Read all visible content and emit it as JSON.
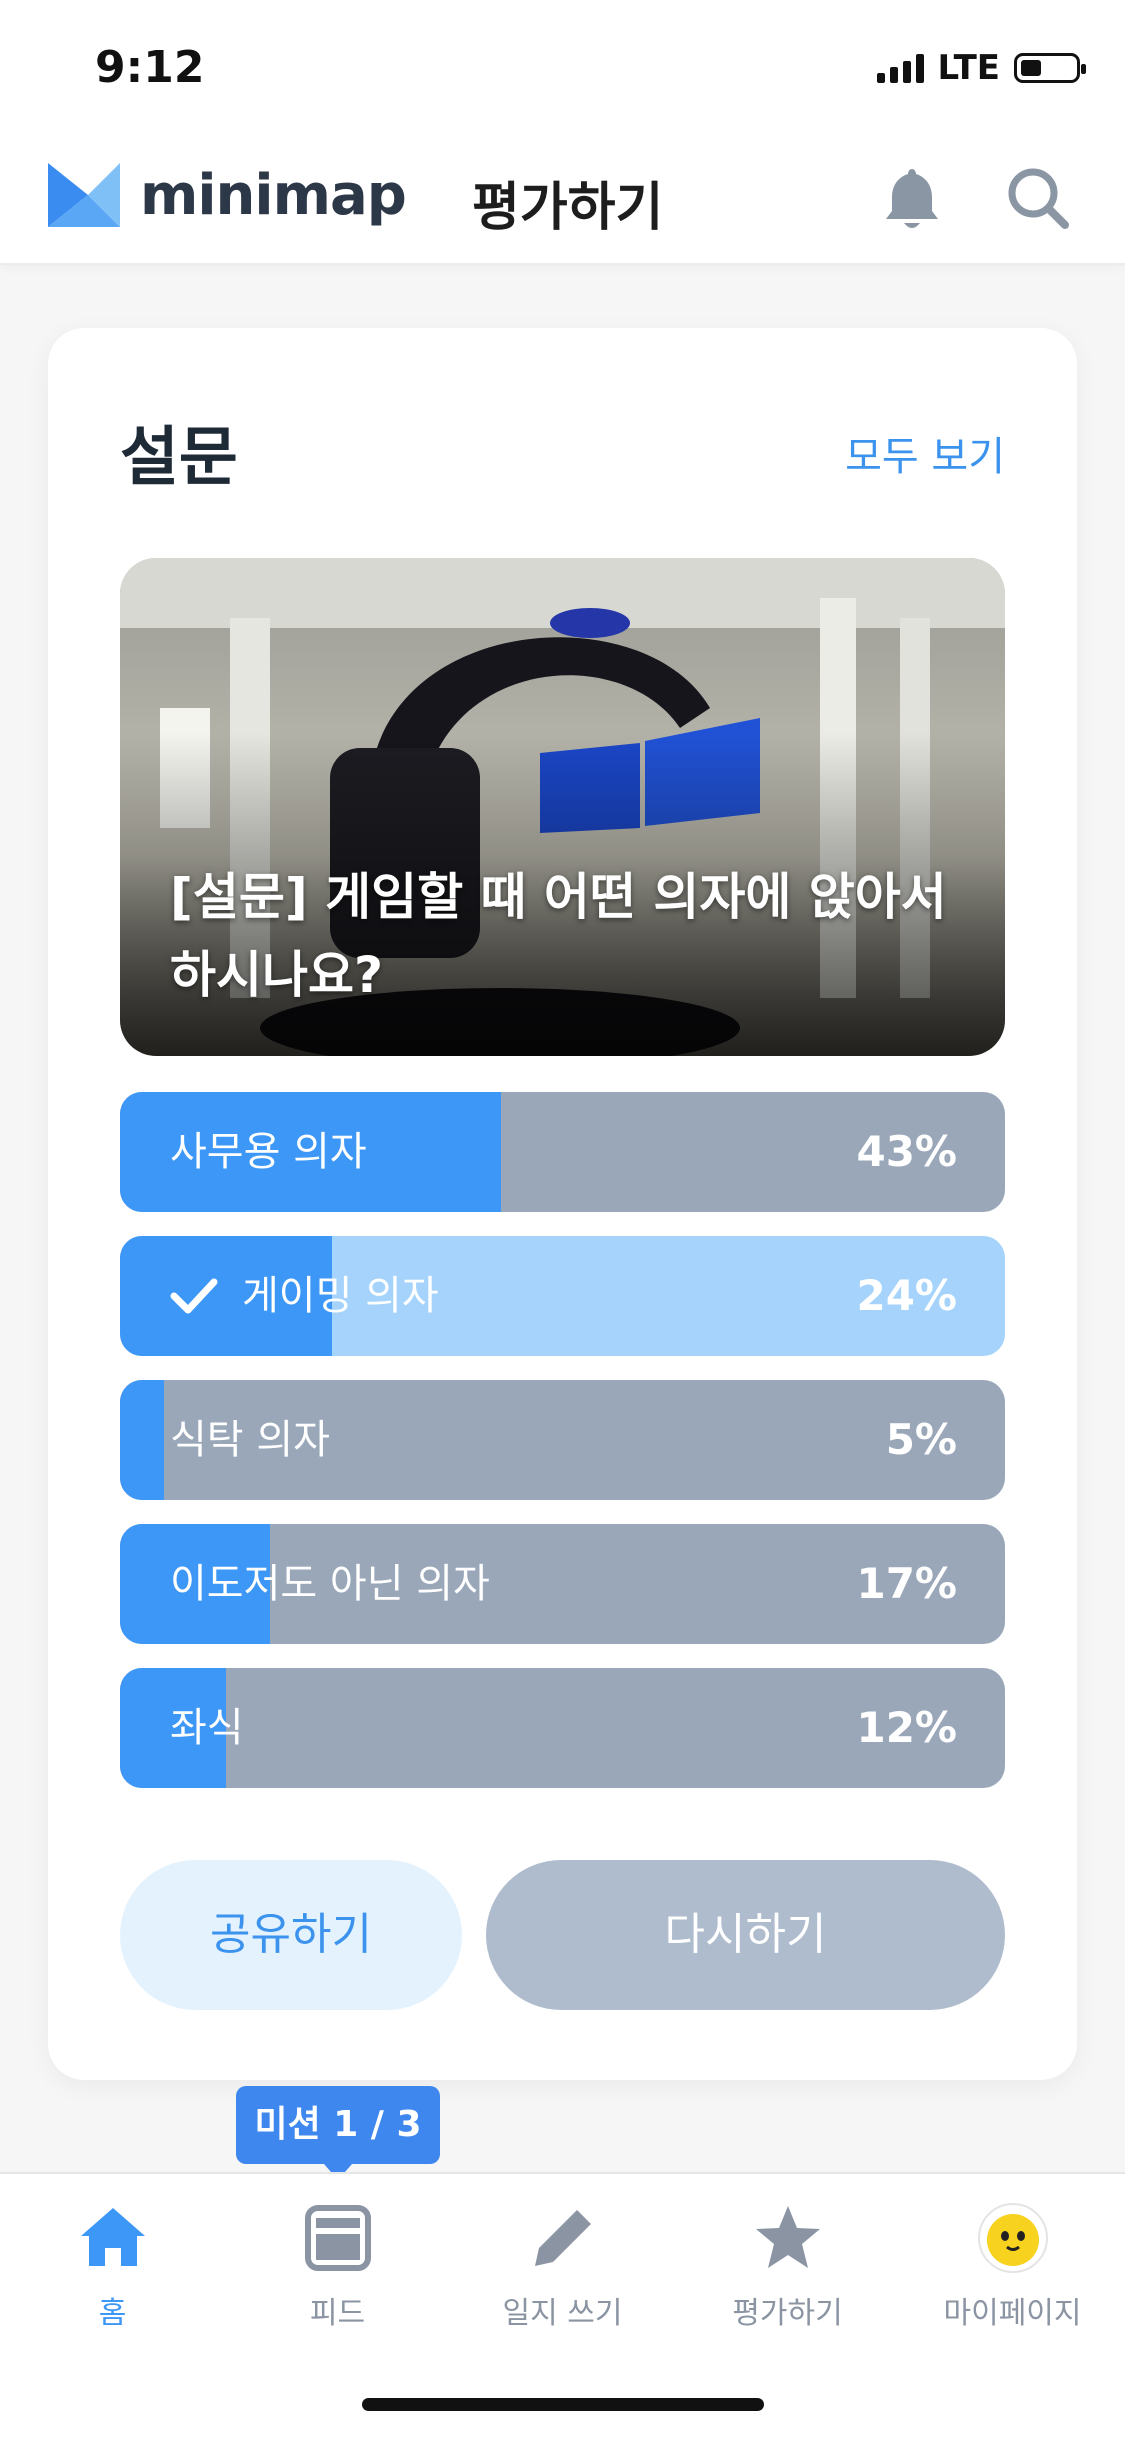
{
  "status_bar": {
    "time": "9:12",
    "network": "LTE"
  },
  "header": {
    "logo_text": "minimap",
    "title": "평가하기"
  },
  "survey_card": {
    "title": "설문",
    "see_all": "모두 보기",
    "question": "[설문] 게임할 때 어떤 의자에 앉아서 하시나요?",
    "options": [
      {
        "label": "사무용 의자",
        "percent": "43%",
        "fraction": 0.43,
        "selected": false
      },
      {
        "label": "게이밍 의자",
        "percent": "24%",
        "fraction": 0.24,
        "selected": true
      },
      {
        "label": "식탁 의자",
        "percent": "5%",
        "fraction": 0.05,
        "selected": false
      },
      {
        "label": "이도저도 아닌 의자",
        "percent": "17%",
        "fraction": 0.17,
        "selected": false
      },
      {
        "label": "좌식",
        "percent": "12%",
        "fraction": 0.12,
        "selected": false
      }
    ],
    "share_button": "공유하기",
    "retry_button": "다시하기"
  },
  "mission_badge": "미션 1 / 3",
  "tabs": [
    {
      "label": "홈",
      "icon": "home-icon",
      "active": true
    },
    {
      "label": "피드",
      "icon": "feed-icon",
      "active": false
    },
    {
      "label": "일지 쓰기",
      "icon": "pencil-icon",
      "active": false
    },
    {
      "label": "평가하기",
      "icon": "star-icon",
      "active": false
    },
    {
      "label": "마이페이지",
      "icon": "avatar-icon",
      "active": false
    }
  ],
  "colors": {
    "accent": "#3d97f6",
    "bar_bg": "#9aa7b9",
    "selected_bg": "#a5d3fb"
  }
}
